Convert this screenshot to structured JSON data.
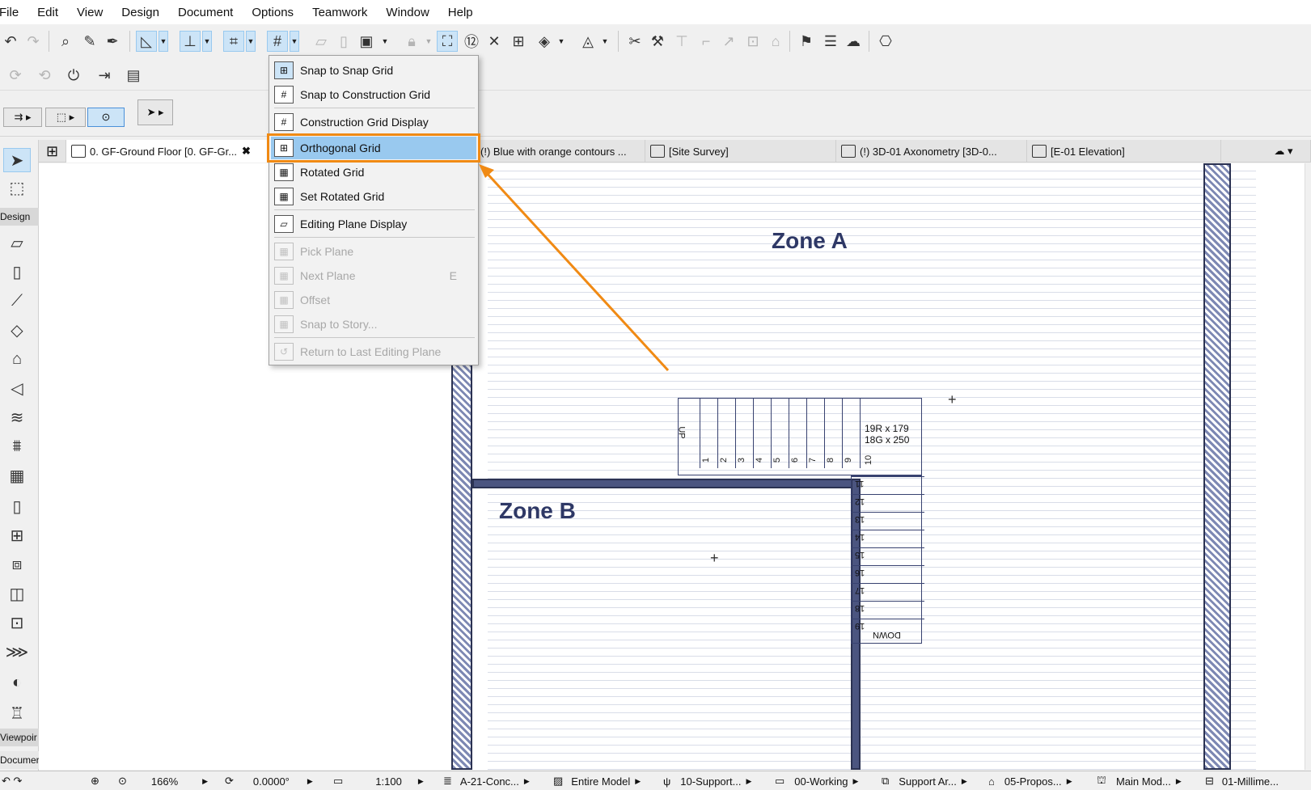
{
  "menubar": [
    "File",
    "Edit",
    "View",
    "Design",
    "Document",
    "Options",
    "Teamwork",
    "Window",
    "Help"
  ],
  "toolbar1_icons": [
    "undo-icon",
    "redo-icon",
    "find-select-icon",
    "pick-up-icon",
    "inject-icon",
    "guide-lines-icon",
    "snap-guides-icon",
    "coordinate-icon",
    "grid-snap-icon",
    "plane-icon",
    "trace-icon",
    "suspend-groups-icon",
    "lock-icon",
    "renovation-icon",
    "zoom-icon",
    "split-icon",
    "trim-icon"
  ],
  "toolbar3": {
    "group1": "⇉ ▸",
    "group2": "⬚ ▸",
    "group3": "⊙",
    "arrow": "➤ ▸"
  },
  "tabs": [
    {
      "label": "0. GF-Ground Floor [0. GF-Gr...",
      "close": "✖"
    },
    {
      "label": "(!) Blue with orange contours ..."
    },
    {
      "label": "[Site Survey]"
    },
    {
      "label": "(!) 3D-01 Axonometry [3D-0..."
    },
    {
      "label": "[E-01 Elevation]"
    }
  ],
  "toolbox": {
    "design_label": "Design",
    "viewpoint_label": "Viewpoir",
    "document_label": "Documer"
  },
  "menu": {
    "items": [
      {
        "label": "Snap to Snap Grid",
        "icon": "snap-grid-icon",
        "enabled": true
      },
      {
        "label": "Snap to Construction Grid",
        "icon": "construction-grid-icon",
        "enabled": true
      },
      {
        "label": "Construction Grid Display",
        "icon": "grid-display-icon",
        "enabled": true
      },
      {
        "label": "Orthogonal Grid",
        "icon": "orthogonal-grid-icon",
        "enabled": true,
        "highlighted": true
      },
      {
        "label": "Rotated Grid",
        "icon": "rotated-grid-icon",
        "enabled": true
      },
      {
        "label": "Set Rotated Grid",
        "icon": "set-rotated-grid-icon",
        "enabled": true
      },
      {
        "label": "Editing Plane Display",
        "icon": "editing-plane-icon",
        "enabled": true
      },
      {
        "label": "Pick Plane",
        "icon": "pick-plane-icon",
        "enabled": false
      },
      {
        "label": "Next Plane",
        "shortcut": "E",
        "icon": "next-plane-icon",
        "enabled": false
      },
      {
        "label": "Offset",
        "icon": "offset-icon",
        "enabled": false
      },
      {
        "label": "Snap to Story...",
        "icon": "snap-story-icon",
        "enabled": false
      },
      {
        "label": "Return to Last Editing Plane",
        "icon": "return-plane-icon",
        "enabled": false
      }
    ]
  },
  "canvas": {
    "zone_a": "Zone A",
    "zone_b": "Zone B",
    "stair_note_1": "19R x 179",
    "stair_note_2": "18G x 250",
    "stair_up": "UP",
    "stair_down": "DOWN",
    "stair_steps_top": [
      "1",
      "2",
      "3",
      "4",
      "5",
      "6",
      "7",
      "8",
      "9",
      "10"
    ],
    "stair_steps_side": [
      "11",
      "12",
      "13",
      "14",
      "15",
      "16",
      "17",
      "18",
      "19"
    ]
  },
  "statusbar": {
    "zoom": "166%",
    "angle": "0.0000°",
    "scale": "1:100",
    "layer_combo": "A-21-Conc...",
    "model_view": "Entire Model",
    "pen_set": "10-Support...",
    "renovation": "00-Working",
    "structural": "Support Ar...",
    "partial": "05-Propos...",
    "mvo": "Main Mod...",
    "dimension": "01-Millime..."
  },
  "colors": {
    "highlight": "#99c9ef",
    "annotation": "#f08a14",
    "wall": "#4b5580",
    "zone_text": "#2e3866"
  }
}
